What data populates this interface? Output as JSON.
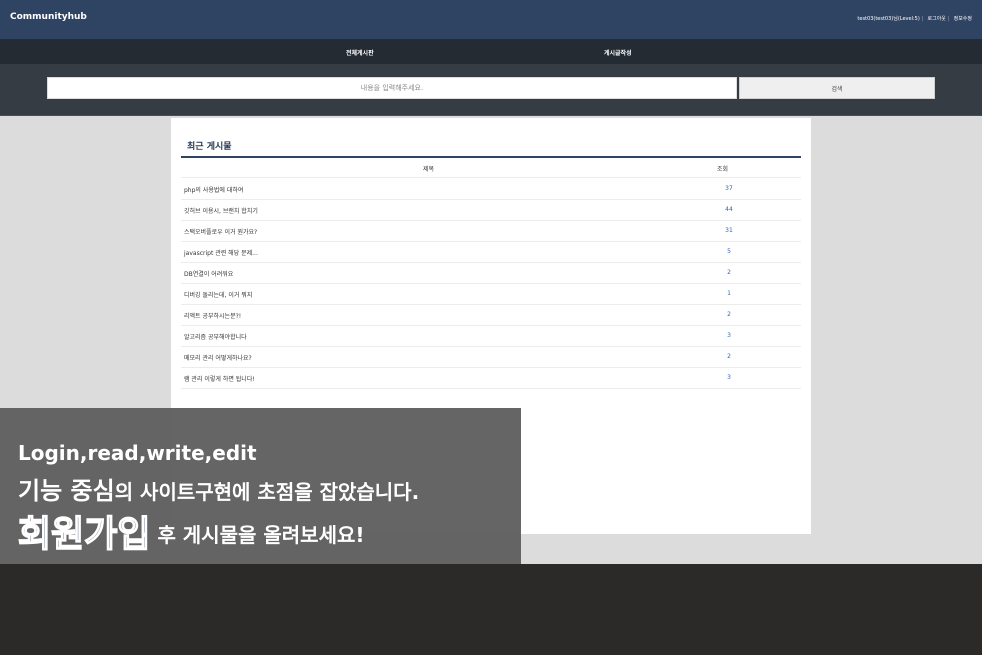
{
  "header": {
    "brand": "Communityhub",
    "user_text": "test03(test03)님(Level:5)",
    "logout": "로그아웃",
    "profile_edit": "정보수정"
  },
  "nav": {
    "items": [
      "전체게시판",
      "게시글작성"
    ]
  },
  "search": {
    "placeholder": "내용을 입력해주세요.",
    "button": "검색"
  },
  "board": {
    "title": "최근 게시물",
    "columns": [
      "제목",
      "조회"
    ],
    "rows": [
      {
        "title": "php의 사용법에 대하여",
        "views": "37"
      },
      {
        "title": "깃허브 이용시, 브랜치 합치기",
        "views": "44"
      },
      {
        "title": "스택오버플로우 이거 뭔가요?",
        "views": "31"
      },
      {
        "title": "javascript 관련 해당 문제...",
        "views": "5"
      },
      {
        "title": "DB연결이 어려워요",
        "views": "2"
      },
      {
        "title": "디버깅 돌리는데, 이거 뭐지",
        "views": "1"
      },
      {
        "title": "리액트 공부하시는분?!",
        "views": "2"
      },
      {
        "title": "알고리즘 공부해야합니다",
        "views": "3"
      },
      {
        "title": "메모리 관리 어떻게하나요?",
        "views": "2"
      },
      {
        "title": "램 관리 이렇게 하면 됩니다!",
        "views": "3"
      }
    ]
  },
  "overlay": {
    "line1": "Login,read,write,edit",
    "line2_bold": "기능 중심",
    "line2_rest": "의 사이트구현에   초점을 잡았습니다.",
    "line3_bold": "회원가입",
    "line3_rest": " 후 게시물을 올려보세요!"
  }
}
